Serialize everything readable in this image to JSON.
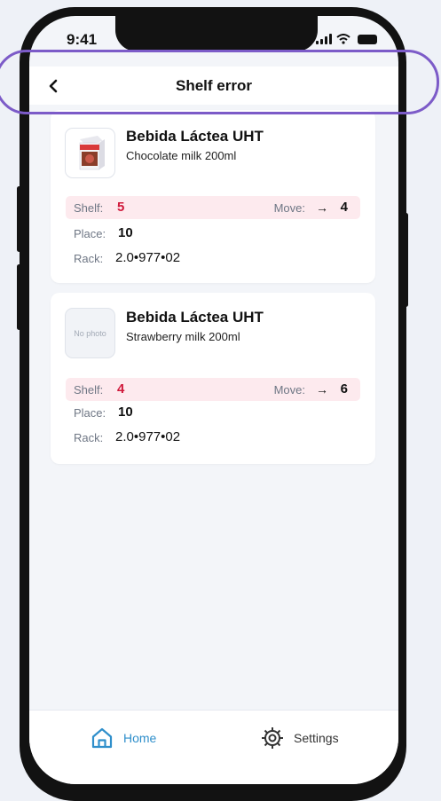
{
  "status_bar": {
    "time": "9:41"
  },
  "header": {
    "title": "Shelf error"
  },
  "products": [
    {
      "name": "Bebida Láctea UHT",
      "description": "Chocolate milk 200ml",
      "has_photo": true,
      "shelf_label": "Shelf:",
      "shelf_value": "5",
      "move_label": "Move:",
      "move_arrow": "→",
      "move_value": "4",
      "place_label": "Place:",
      "place_value": "10",
      "rack_label": "Rack:",
      "rack_value": "2.0•977•02"
    },
    {
      "name": "Bebida Láctea UHT",
      "description": "Strawberry milk 200ml",
      "has_photo": false,
      "no_photo_text": "No photo",
      "shelf_label": "Shelf:",
      "shelf_value": "4",
      "move_label": "Move:",
      "move_arrow": "→",
      "move_value": "6",
      "place_label": "Place:",
      "place_value": "10",
      "rack_label": "Rack:",
      "rack_value": "2.0•977•02"
    }
  ],
  "bottom_nav": {
    "home_label": "Home",
    "settings_label": "Settings"
  },
  "colors": {
    "accent": "#2f8fcb",
    "highlight": "#7c5bc8",
    "shelf_error_bg": "#fdeaee",
    "shelf_error_text": "#d0193b"
  },
  "icons": [
    "back-chevron-icon",
    "home-icon",
    "settings-gear-icon",
    "wifi-icon",
    "signal-icon",
    "battery-icon",
    "product-photo"
  ]
}
